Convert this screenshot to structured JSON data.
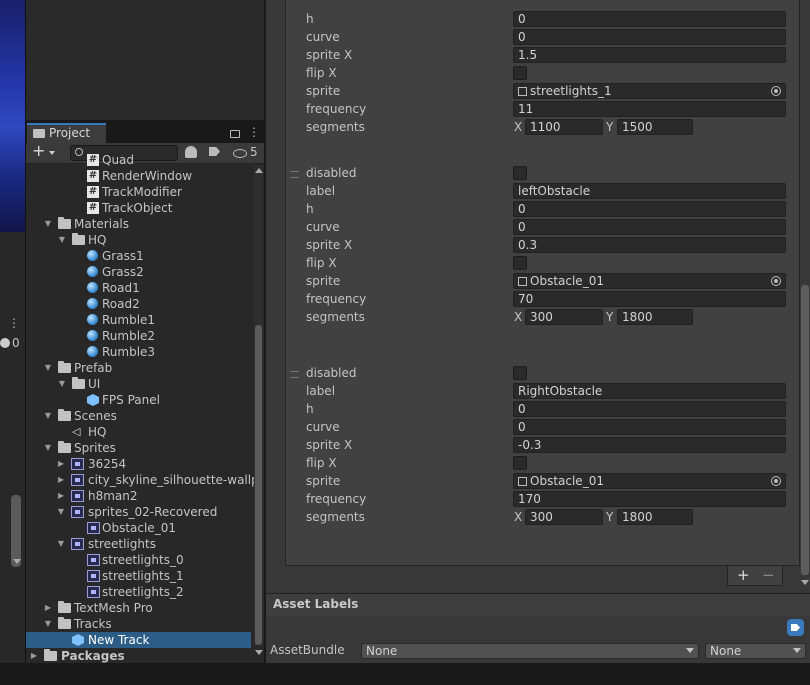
{
  "project": {
    "tab_label": "Project",
    "add_label": "+",
    "hidden_count": "5",
    "left_badge": "0",
    "tree": [
      {
        "label": "Quad",
        "type": "script"
      },
      {
        "label": "RenderWindow",
        "type": "script"
      },
      {
        "label": "TrackModifier",
        "type": "script"
      },
      {
        "label": "TrackObject",
        "type": "script"
      },
      {
        "label": "Materials",
        "type": "folder"
      },
      {
        "label": "HQ",
        "type": "folder"
      },
      {
        "label": "Grass1",
        "type": "material"
      },
      {
        "label": "Grass2",
        "type": "material"
      },
      {
        "label": "Road1",
        "type": "material"
      },
      {
        "label": "Road2",
        "type": "material"
      },
      {
        "label": "Rumble1",
        "type": "material"
      },
      {
        "label": "Rumble2",
        "type": "material"
      },
      {
        "label": "Rumble3",
        "type": "material"
      },
      {
        "label": "Prefab",
        "type": "folder"
      },
      {
        "label": "UI",
        "type": "folder"
      },
      {
        "label": "FPS Panel",
        "type": "prefab"
      },
      {
        "label": "Scenes",
        "type": "folder"
      },
      {
        "label": "HQ",
        "type": "scene"
      },
      {
        "label": "Sprites",
        "type": "folder"
      },
      {
        "label": "36254",
        "type": "texture"
      },
      {
        "label": "city_skyline_silhouette-wallp",
        "type": "texture"
      },
      {
        "label": "h8man2",
        "type": "texture"
      },
      {
        "label": "sprites_02-Recovered",
        "type": "texture"
      },
      {
        "label": "Obstacle_01",
        "type": "sprite"
      },
      {
        "label": "streetlights",
        "type": "texture"
      },
      {
        "label": "streetlights_0",
        "type": "sprite"
      },
      {
        "label": "streetlights_1",
        "type": "sprite"
      },
      {
        "label": "streetlights_2",
        "type": "sprite"
      },
      {
        "label": "TextMesh Pro",
        "type": "folder"
      },
      {
        "label": "Tracks",
        "type": "folder"
      },
      {
        "label": "New Track",
        "type": "track"
      },
      {
        "label": "Packages",
        "type": "folder"
      }
    ]
  },
  "inspector": {
    "labels": {
      "disabled": "disabled",
      "label": "label",
      "h": "h",
      "curve": "curve",
      "sprite_x": "sprite X",
      "flip_x": "flip X",
      "sprite": "sprite",
      "frequency": "frequency",
      "segments": "segments",
      "seg_x": "X",
      "seg_y": "Y"
    },
    "elements": [
      {
        "h": "0",
        "curve": "0",
        "sprite_x": "1.5",
        "sprite": "streetlights_1",
        "frequency": "11",
        "seg_x": "1100",
        "seg_y": "1500"
      },
      {
        "label": "leftObstacle",
        "h": "0",
        "curve": "0",
        "sprite_x": "0.3",
        "sprite": "Obstacle_01",
        "frequency": "70",
        "seg_x": "300",
        "seg_y": "1800"
      },
      {
        "label": "RightObstacle",
        "h": "0",
        "curve": "0",
        "sprite_x": "-0.3",
        "sprite": "Obstacle_01",
        "frequency": "170",
        "seg_x": "300",
        "seg_y": "1800"
      }
    ],
    "add_label": "+",
    "remove_label": "−",
    "asset_labels_title": "Asset Labels",
    "assetbundle_label": "AssetBundle",
    "assetbundle_value": "None",
    "assetbundle_variant": "None"
  },
  "colors": {
    "selection": "#2c5d87",
    "accent": "#3a79bb"
  }
}
